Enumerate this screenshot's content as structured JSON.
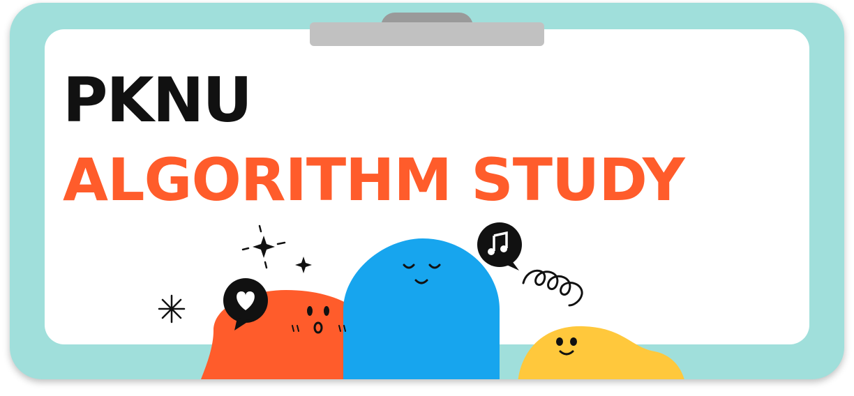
{
  "title": {
    "line1": "PKNU",
    "line2": "ALGORITHM STUDY"
  },
  "colors": {
    "frame": "#a0dfdb",
    "board": "#ffffff",
    "title_primary": "#111111",
    "title_accent": "#ff5c2b",
    "blob_orange": "#ff5c2b",
    "blob_blue": "#17a5ee",
    "blob_yellow": "#ffc83c"
  },
  "icons": [
    "sparkle-icon",
    "heart-bubble-icon",
    "music-note-bubble-icon",
    "squiggle-icon",
    "asterisk-icon"
  ]
}
